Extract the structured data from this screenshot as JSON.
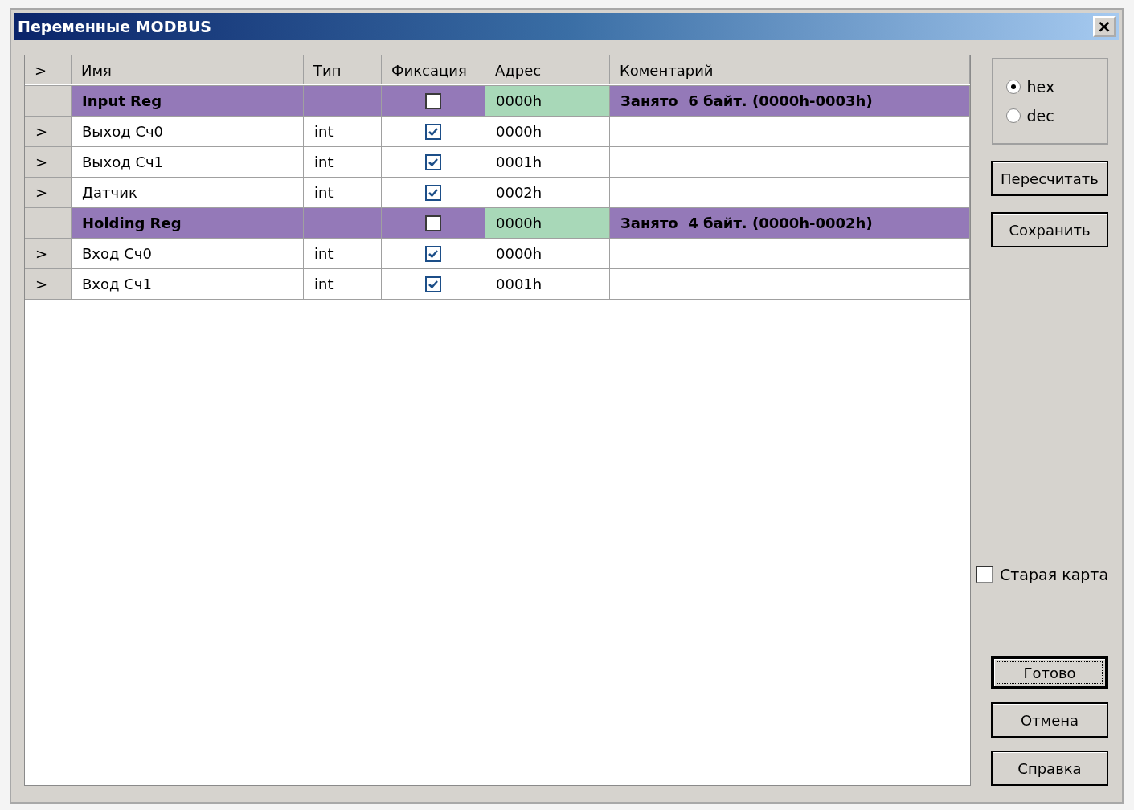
{
  "window": {
    "title": "Переменные MODBUS",
    "close": "×"
  },
  "table": {
    "columns": [
      ">",
      "Имя",
      "Тип",
      "Фиксация",
      "Адрес",
      "Коментарий"
    ],
    "rows": [
      {
        "kind": "group",
        "marker": "",
        "name": "Input Reg",
        "type": "",
        "fixed": false,
        "address": "0000h",
        "comment": "Занято  6 байт. (0000h-0003h)"
      },
      {
        "kind": "item",
        "marker": ">",
        "name": "Выход Сч0",
        "type": "int",
        "fixed": true,
        "address": "0000h",
        "comment": ""
      },
      {
        "kind": "item",
        "marker": ">",
        "name": "Выход Сч1",
        "type": "int",
        "fixed": true,
        "address": "0001h",
        "comment": ""
      },
      {
        "kind": "item",
        "marker": ">",
        "name": "Датчик",
        "type": "int",
        "fixed": true,
        "address": "0002h",
        "comment": ""
      },
      {
        "kind": "group",
        "marker": "",
        "name": "Holding Reg",
        "type": "",
        "fixed": false,
        "address": "0000h",
        "comment": "Занято  4 байт. (0000h-0002h)"
      },
      {
        "kind": "item",
        "marker": ">",
        "name": "Вход Сч0",
        "type": "int",
        "fixed": true,
        "address": "0000h",
        "comment": ""
      },
      {
        "kind": "item",
        "marker": ">",
        "name": "Вход Сч1",
        "type": "int",
        "fixed": true,
        "address": "0001h",
        "comment": ""
      }
    ]
  },
  "format": [
    {
      "label": "hex",
      "selected": true
    },
    {
      "label": "dec",
      "selected": false
    }
  ],
  "top_buttons": [
    "Пересчитать",
    "Сохранить"
  ],
  "old_map": {
    "label": "Старая карта",
    "checked": false
  },
  "bottom_buttons": [
    {
      "label": "Готово",
      "default": true
    },
    {
      "label": "Отмена",
      "default": false
    },
    {
      "label": "Справка",
      "default": false
    }
  ]
}
